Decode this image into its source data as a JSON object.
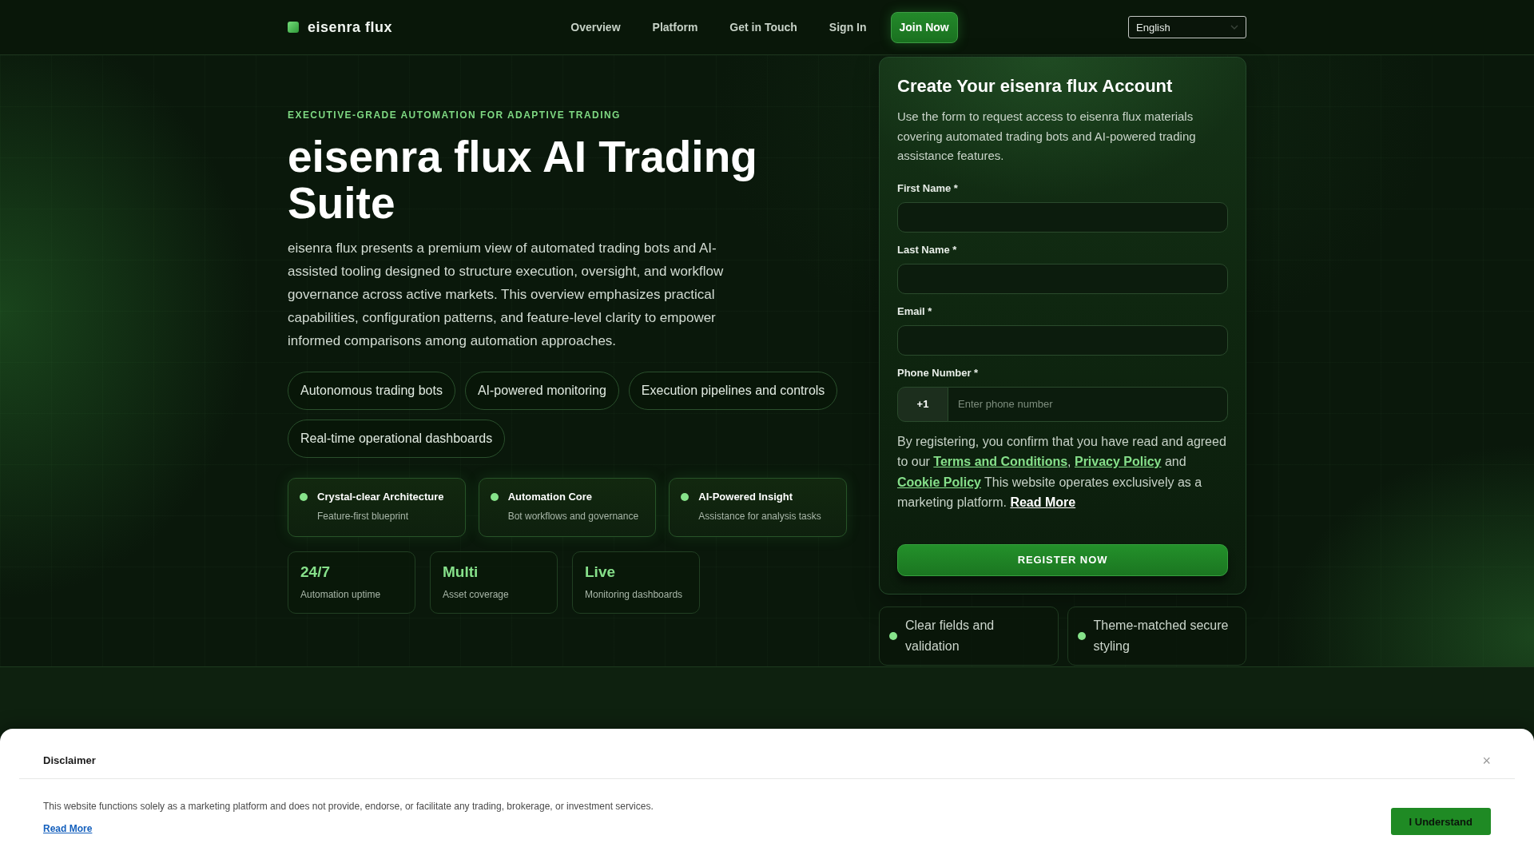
{
  "header": {
    "brand": "eisenra flux",
    "nav": [
      {
        "label": "Overview"
      },
      {
        "label": "Platform"
      },
      {
        "label": "Get in Touch"
      },
      {
        "label": "Sign In"
      }
    ],
    "cta": "Join Now",
    "language": "English"
  },
  "hero": {
    "eyebrow": "EXECUTIVE-GRADE AUTOMATION FOR ADAPTIVE TRADING",
    "title": "eisenra flux AI Trading Suite",
    "description": "eisenra flux presents a premium view of automated trading bots and AI-assisted tooling designed to structure execution, oversight, and workflow governance across active markets. This overview emphasizes practical capabilities, configuration patterns, and feature-level clarity to empower informed comparisons among automation approaches.",
    "tags": [
      "Autonomous trading bots",
      "AI-powered monitoring",
      "Execution pipelines and controls",
      "Real-time operational dashboards"
    ],
    "highlights": [
      {
        "title": "Crystal-clear Architecture",
        "subtitle": "Feature-first blueprint"
      },
      {
        "title": "Automation Core",
        "subtitle": "Bot workflows and governance"
      },
      {
        "title": "AI-Powered Insight",
        "subtitle": "Assistance for analysis tasks"
      }
    ],
    "stats": [
      {
        "value": "24/7",
        "label": "Automation uptime"
      },
      {
        "value": "Multi",
        "label": "Asset coverage"
      },
      {
        "value": "Live",
        "label": "Monitoring dashboards"
      }
    ]
  },
  "signup": {
    "title": "Create Your eisenra flux Account",
    "description": "Use the form to request access to eisenra flux materials covering automated trading bots and AI-powered trading assistance features.",
    "fields": [
      {
        "kind": "text",
        "label": "First Name *"
      },
      {
        "kind": "text",
        "label": "Last Name *"
      },
      {
        "kind": "email",
        "label": "Email *"
      },
      {
        "kind": "phone",
        "label": "Phone Number *",
        "prefix": "+1",
        "placeholder": "Enter phone number"
      }
    ],
    "consent": [
      {
        "kind": "text",
        "text": "By registering, you confirm that you have read and agreed to our "
      },
      {
        "kind": "link",
        "text": "Terms and Conditions"
      },
      {
        "kind": "text",
        "text": ", "
      },
      {
        "kind": "link",
        "text": "Privacy Policy"
      },
      {
        "kind": "text",
        "text": " and "
      },
      {
        "kind": "link",
        "text": "Cookie Policy"
      },
      {
        "kind": "text",
        "text": " This website operates exclusively as a marketing platform. "
      },
      {
        "kind": "more",
        "text": "Read More"
      }
    ],
    "submit": "REGISTER NOW",
    "notes": [
      "Clear fields and validation",
      "Theme-matched secure styling"
    ]
  },
  "disclaimer": {
    "title": "Disclaimer",
    "close": "×",
    "text": "This website functions solely as a marketing platform and does not provide, endorse, or facilitate any trading, brokerage, or investment services.",
    "link": "Read More",
    "button": "I Understand"
  }
}
